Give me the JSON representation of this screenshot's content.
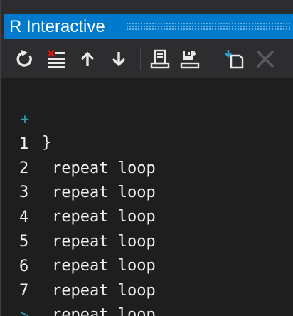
{
  "window": {
    "title": "R Interactive"
  },
  "toolbar": {
    "buttons": [
      {
        "name": "reset-icon"
      },
      {
        "name": "clear-icon"
      },
      {
        "name": "history-up-icon"
      },
      {
        "name": "history-down-icon"
      },
      {
        "name": "load-workspace-icon"
      },
      {
        "name": "save-workspace-icon"
      },
      {
        "name": "set-directory-icon"
      },
      {
        "name": "interrupt-icon"
      }
    ]
  },
  "console": {
    "continuation_prompt": "+",
    "continuation_text": "}",
    "output_lines": [
      {
        "num": "1",
        "text": "repeat loop"
      },
      {
        "num": "2",
        "text": "repeat loop"
      },
      {
        "num": "3",
        "text": "repeat loop"
      },
      {
        "num": "4",
        "text": "repeat loop"
      },
      {
        "num": "5",
        "text": "repeat loop"
      },
      {
        "num": "6",
        "text": "repeat loop"
      },
      {
        "num": "7",
        "text": "repeat loop"
      }
    ],
    "input_prompt": ">"
  },
  "colors": {
    "accent": "#007acc",
    "prompt": "#2aa3b0",
    "text": "#f1f1f1",
    "background": "#1e1e1e",
    "delete_red": "#e51400"
  }
}
